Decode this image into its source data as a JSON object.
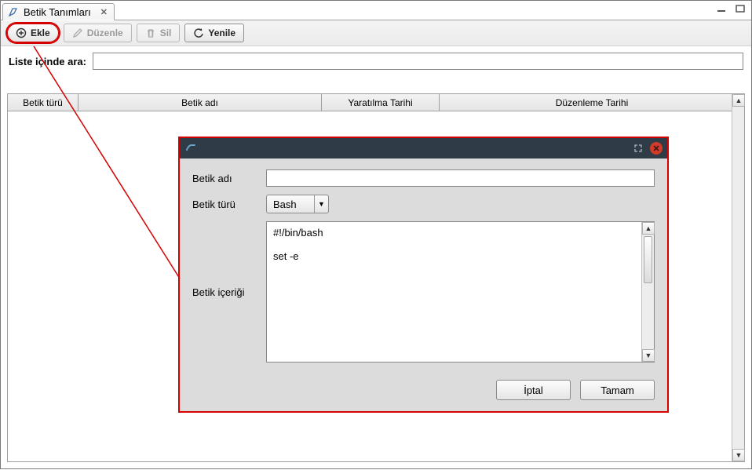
{
  "tab": {
    "title": "Betik Tanımları"
  },
  "toolbar": {
    "add_label": "Ekle",
    "edit_label": "Düzenle",
    "delete_label": "Sil",
    "refresh_label": "Yenile"
  },
  "search": {
    "label": "Liste içinde ara:",
    "value": ""
  },
  "table": {
    "columns": [
      "Betik türü",
      "Betik adı",
      "Yaratılma Tarihi",
      "Düzenleme Tarihi"
    ],
    "rows": []
  },
  "modal": {
    "fields": {
      "name_label": "Betik adı",
      "name_value": "",
      "type_label": "Betik türü",
      "type_value": "Bash",
      "content_label": "Betik içeriği",
      "content_value": "#!/bin/bash\n\nset -e"
    },
    "buttons": {
      "cancel": "İptal",
      "ok": "Tamam"
    }
  }
}
